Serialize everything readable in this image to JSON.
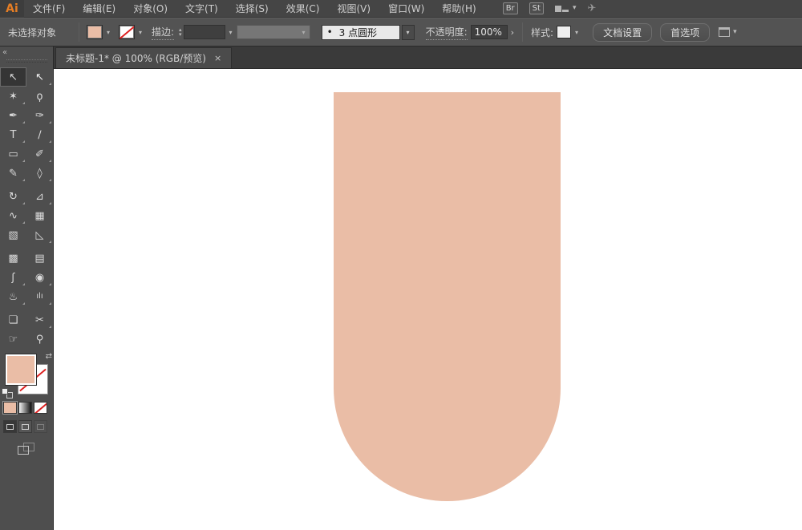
{
  "app_logo": "Ai",
  "menubar": {
    "items": [
      "文件(F)",
      "编辑(E)",
      "对象(O)",
      "文字(T)",
      "选择(S)",
      "效果(C)",
      "视图(V)",
      "窗口(W)",
      "帮助(H)"
    ],
    "br_badge": "Br",
    "st_badge": "St"
  },
  "controlbar": {
    "status": "未选择对象",
    "stroke_label": "描边:",
    "brush_bullet": "•",
    "brush_name": "3 点圆形",
    "opacity_label": "不透明度:",
    "opacity_value": "100%",
    "opacity_more": "›",
    "style_label": "样式:",
    "doc_setup_button": "文档设置",
    "preferences_button": "首选项"
  },
  "tabbar": {
    "title": "未标题-1* @ 100% (RGB/预览)",
    "close": "×",
    "collapse": "«"
  },
  "icons": {
    "chevron": "▾",
    "stepper_up": "▴",
    "stepper_down": "▾",
    "swap": "⇄",
    "launch": "✈"
  },
  "tools": [
    {
      "name": "selection",
      "glyph": "↖"
    },
    {
      "name": "direct-selection",
      "glyph": "↖"
    },
    {
      "name": "magic-wand",
      "glyph": "✶"
    },
    {
      "name": "lasso",
      "glyph": "ϙ"
    },
    {
      "name": "pen",
      "glyph": "✒"
    },
    {
      "name": "ink-pen",
      "glyph": "✑"
    },
    {
      "name": "type",
      "glyph": "T"
    },
    {
      "name": "line-segment",
      "glyph": "∕"
    },
    {
      "name": "rectangle",
      "glyph": "▭"
    },
    {
      "name": "paintbrush",
      "glyph": "✐"
    },
    {
      "name": "pencil",
      "glyph": "✎"
    },
    {
      "name": "eraser",
      "glyph": "◊"
    },
    {
      "name": "rotate",
      "glyph": "↻"
    },
    {
      "name": "scale",
      "glyph": "⊿"
    },
    {
      "name": "width",
      "glyph": "∿"
    },
    {
      "name": "free-transform",
      "glyph": "▦"
    },
    {
      "name": "shape-builder",
      "glyph": "▧"
    },
    {
      "name": "perspective-grid",
      "glyph": "◺"
    },
    {
      "name": "mesh",
      "glyph": "▩"
    },
    {
      "name": "gradient",
      "glyph": "▤"
    },
    {
      "name": "eyedropper",
      "glyph": "ʃ"
    },
    {
      "name": "blend",
      "glyph": "◉"
    },
    {
      "name": "symbol-sprayer",
      "glyph": "♨"
    },
    {
      "name": "column-graph",
      "glyph": "ılı"
    },
    {
      "name": "artboard",
      "glyph": "❏"
    },
    {
      "name": "slice",
      "glyph": "✂"
    },
    {
      "name": "hand",
      "glyph": "☞"
    },
    {
      "name": "zoom",
      "glyph": "⚲"
    }
  ],
  "shape": {
    "fill_color": "#EABDA6",
    "description": "rectangle with semicircular bottom on white artboard"
  },
  "ui_colors": {
    "menubar_bg": "#454545",
    "controlbar_bg": "#535353",
    "panel_bg": "#4E4E4E",
    "tab_active_bg": "#4B4B4B",
    "canvas_bg": "#FFFFFF",
    "stroke_none_red": "#DD2222"
  }
}
